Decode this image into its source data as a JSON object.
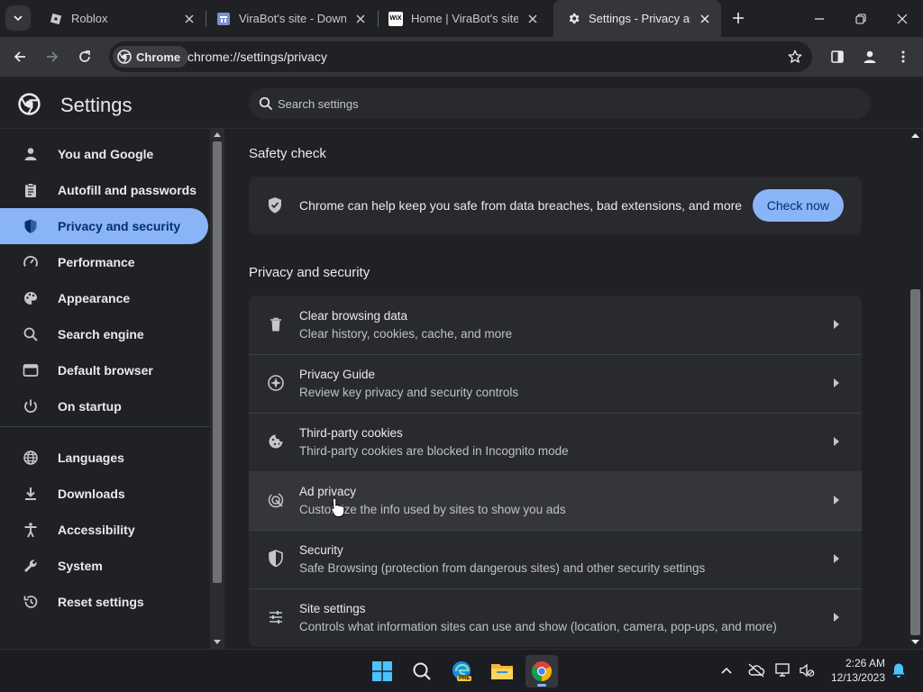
{
  "tabs": [
    {
      "title": "Roblox",
      "favicon": "roblox-icon",
      "active": false
    },
    {
      "title": "ViraBot's site - Downlo",
      "favicon": "site-icon",
      "active": false
    },
    {
      "title": "Home | ViraBot's site",
      "favicon": "wix-icon",
      "favicon_text": "WiX",
      "active": false
    },
    {
      "title": "Settings - Privacy and",
      "favicon": "gear-icon",
      "active": true
    }
  ],
  "toolbar": {
    "chip_label": "Chrome",
    "url": "chrome://settings/privacy"
  },
  "settings": {
    "title": "Settings",
    "search_placeholder": "Search settings"
  },
  "sidebar": {
    "items": [
      {
        "label": "You and Google",
        "icon": "person-icon"
      },
      {
        "label": "Autofill and passwords",
        "icon": "clipboard-icon"
      },
      {
        "label": "Privacy and security",
        "icon": "shield-icon",
        "active": true
      },
      {
        "label": "Performance",
        "icon": "speedometer-icon"
      },
      {
        "label": "Appearance",
        "icon": "palette-icon"
      },
      {
        "label": "Search engine",
        "icon": "search-icon"
      },
      {
        "label": "Default browser",
        "icon": "browser-icon"
      },
      {
        "label": "On startup",
        "icon": "power-icon"
      },
      {
        "label": "Languages",
        "icon": "globe-icon"
      },
      {
        "label": "Downloads",
        "icon": "download-icon"
      },
      {
        "label": "Accessibility",
        "icon": "accessibility-icon"
      },
      {
        "label": "System",
        "icon": "wrench-icon"
      },
      {
        "label": "Reset settings",
        "icon": "reset-icon"
      }
    ]
  },
  "safety_check": {
    "heading": "Safety check",
    "text": "Chrome can help keep you safe from data breaches, bad extensions, and more",
    "button": "Check now"
  },
  "privacy": {
    "heading": "Privacy and security",
    "rows": [
      {
        "title": "Clear browsing data",
        "subtitle": "Clear history, cookies, cache, and more",
        "icon": "trash-icon"
      },
      {
        "title": "Privacy Guide",
        "subtitle": "Review key privacy and security controls",
        "icon": "compass-icon"
      },
      {
        "title": "Third-party cookies",
        "subtitle": "Third-party cookies are blocked in Incognito mode",
        "icon": "cookie-icon"
      },
      {
        "title": "Ad privacy",
        "subtitle": "Customize the info used by sites to show you ads",
        "icon": "ad-privacy-icon",
        "hovered": true
      },
      {
        "title": "Security",
        "subtitle": "Safe Browsing (protection from dangerous sites) and other security settings",
        "icon": "shield-icon"
      },
      {
        "title": "Site settings",
        "subtitle": "Controls what information sites can use and show (location, camera, pop-ups, and more)",
        "icon": "sliders-icon"
      }
    ]
  },
  "taskbar": {
    "edge_badge": "PRE",
    "time": "2:26 AM",
    "date": "12/13/2023"
  },
  "colors": {
    "accent": "#8ab4f8",
    "background": "#202124",
    "card": "#292a2d"
  }
}
